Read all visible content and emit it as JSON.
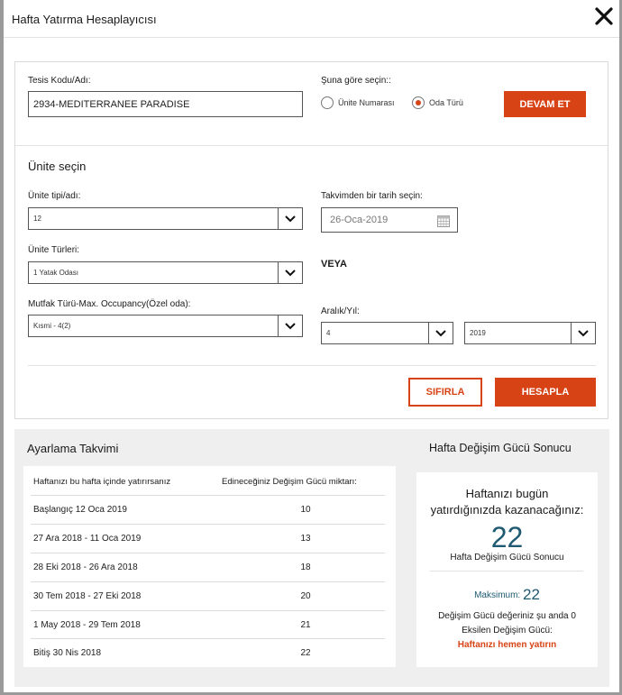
{
  "header": {
    "title": "Hafta Yatırma Hesaplayıcısı"
  },
  "facility": {
    "label": "Tesis Kodu/Adı:",
    "value": "2934-MEDITERRANEE PARADISE"
  },
  "choose_by": {
    "label": "Şuna göre seçin::",
    "options": [
      "Ünite Numarası",
      "Oda Türü"
    ],
    "selected": "Oda Türü"
  },
  "continue_label": "DEVAM ET",
  "unit_section": {
    "title": "Ünite seçin",
    "unit_type_label": "Ünite tipi/adı:",
    "unit_type_value": "12",
    "unit_kinds_label": "Ünite Türleri:",
    "unit_kinds_value": "1 Yatak Odası",
    "kitchen_label": "Mutfak Türü-Max. Occupancy(Özel oda):",
    "kitchen_value": "Kısmi - 4(2)",
    "calendar_label": "Takvimden bir tarih seçin:",
    "calendar_value": "26-Oca-2019",
    "or_label": "VEYA",
    "range_label": "Aralık/Yıl:",
    "range_value": "4",
    "year_value": "2019"
  },
  "reset_label": "SIFIRLA",
  "calculate_label": "HESAPLA",
  "schedule": {
    "title": "Ayarlama Takvimi",
    "col1": "Haftanızı bu hafta içinde yatırırsanız",
    "col2": "Edineceğiniz Değişim Gücü miktarı:",
    "rows": [
      {
        "period": "Başlangıç 12 Oca 2019",
        "value": "10"
      },
      {
        "period": "27 Ara 2018 - 11 Oca 2019",
        "value": "13"
      },
      {
        "period": "28 Eki 2018 - 26 Ara 2018",
        "value": "18"
      },
      {
        "period": "30 Tem 2018 - 27 Eki 2018",
        "value": "20"
      },
      {
        "period": "1 May 2018 - 29 Tem 2018",
        "value": "21"
      },
      {
        "period": "Bitiş 30 Nis 2018",
        "value": "22"
      }
    ]
  },
  "result": {
    "title": "Hafta Değişim Gücü Sonucu",
    "heading_line1": "Haftanızı bugün",
    "heading_line2": "yatırdığınızda kazanacağınız:",
    "big_value": "22",
    "big_caption": "Hafta Değişim Gücü Sonucu",
    "max_label": "Maksimum:",
    "max_value": "22",
    "current_line": "Değişim Gücü değeriniz şu anda 0",
    "reduced_line": "Eksilen Değişim Gücü:",
    "cta": "Haftanızı hemen yatırın"
  },
  "colors": {
    "accent": "#d84315",
    "teal": "#1f5a72",
    "panel_bg": "#efefef"
  },
  "icons": [
    "close-icon",
    "chevron-down-icon",
    "calendar-icon"
  ]
}
